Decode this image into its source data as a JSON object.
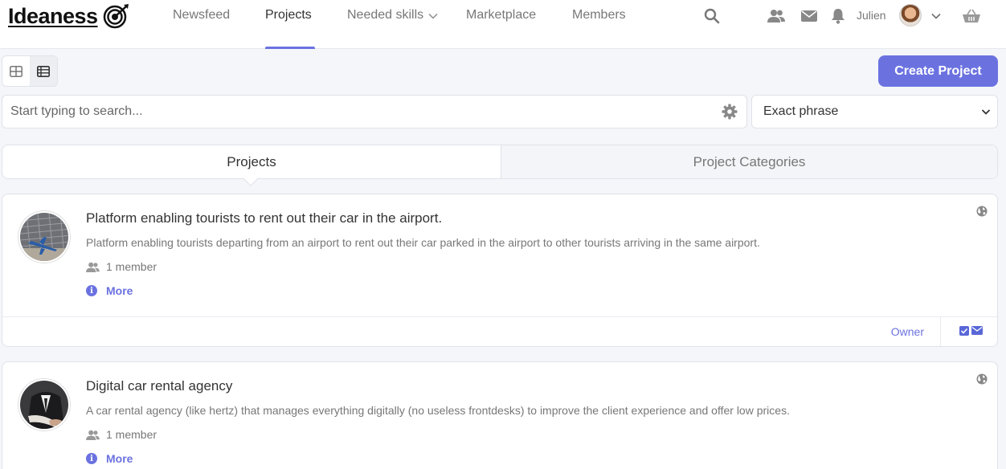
{
  "brand": {
    "name": "Ideaness"
  },
  "nav": {
    "items": [
      {
        "label": "Newsfeed"
      },
      {
        "label": "Projects"
      },
      {
        "label": "Needed skills"
      },
      {
        "label": "Marketplace"
      },
      {
        "label": "Members"
      }
    ],
    "active": "Projects"
  },
  "user": {
    "name": "Julien"
  },
  "toolbar": {
    "create_label": "Create Project"
  },
  "search": {
    "placeholder": "Start typing to search...",
    "value": "",
    "mode": "Exact phrase"
  },
  "tabs": [
    {
      "label": "Projects"
    },
    {
      "label": "Project Categories"
    }
  ],
  "projects": [
    {
      "title": "Platform enabling tourists to rent out their car in the airport.",
      "description": "Platform enabling tourists departing from an airport to rent out their car parked in the airport to other tourists arriving in the same airport.",
      "members": "1 member",
      "more_label": "More",
      "role": "Owner"
    },
    {
      "title": "Digital car rental agency",
      "description": "A car rental agency (like hertz) that manages everything digitally (no useless frontdesks) to improve the client experience and offer low prices.",
      "members": "1 member",
      "more_label": "More"
    }
  ],
  "colors": {
    "accent": "#6b72e0",
    "background": "#f4f6fa",
    "muted_text": "#777777"
  }
}
